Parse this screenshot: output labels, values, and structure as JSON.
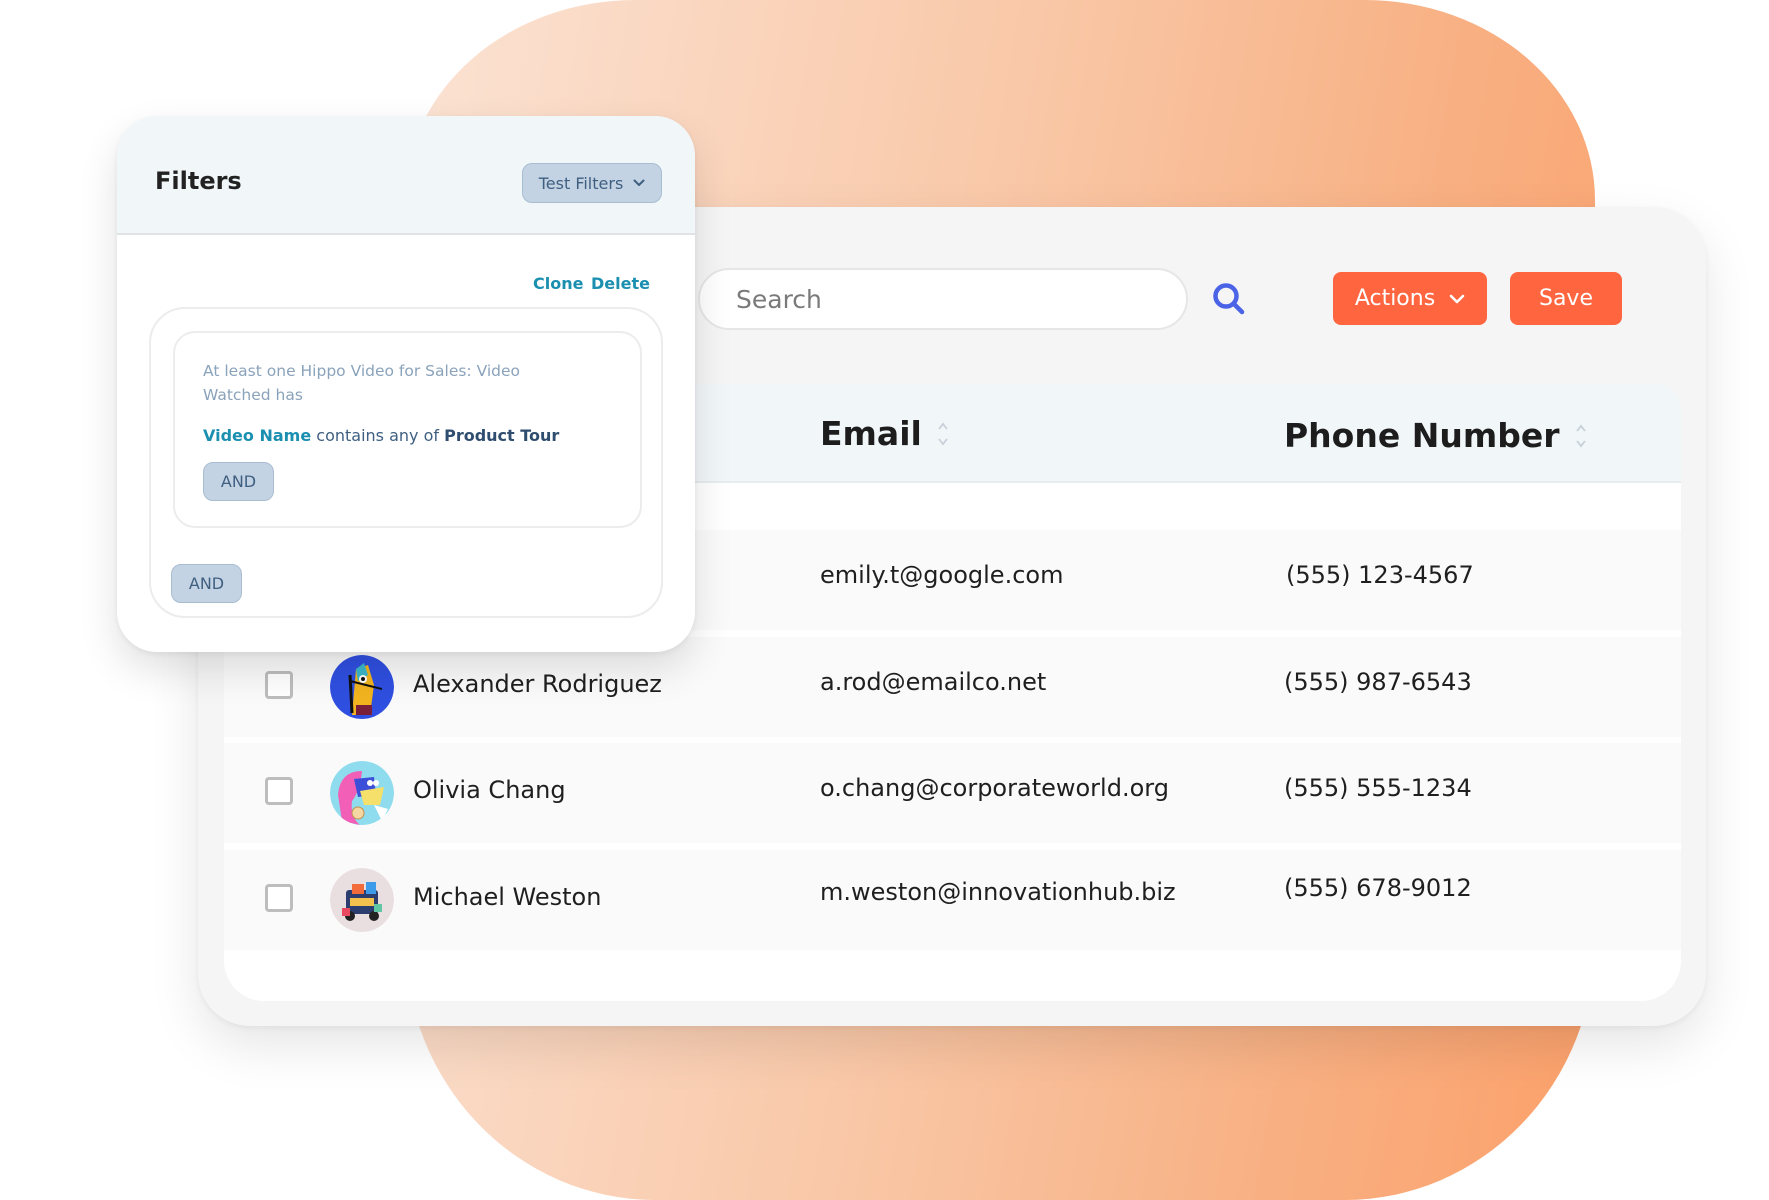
{
  "colors": {
    "accent_orange": "#ff6640",
    "search_icon_blue": "#4a63e7",
    "link_teal": "#1a8fb0",
    "chip_bg": "#c3d3e3",
    "chip_text": "#3f5f81",
    "header_bg": "#f1f6f9"
  },
  "toolbar": {
    "search_placeholder": "Search",
    "search_value": "",
    "search_icon": "search-icon",
    "actions_label": "Actions",
    "actions_icon": "chevron-down-icon",
    "save_label": "Save"
  },
  "table": {
    "columns": [
      {
        "label": "Email",
        "sortable": true
      },
      {
        "label": "Phone Number",
        "sortable": true
      }
    ],
    "rows": [
      {
        "name": "",
        "email": "emily.t@google.com",
        "phone": "(555) 123-4567",
        "checked": false
      },
      {
        "name": "Alexander Rodriguez",
        "email": "a.rod@emailco.net",
        "phone": "(555) 987-6543",
        "checked": false
      },
      {
        "name": "Olivia Chang",
        "email": "o.chang@corporateworld.org",
        "phone": "(555) 555-1234",
        "checked": false
      },
      {
        "name": "Michael Weston",
        "email": "m.weston@innovationhub.biz",
        "phone": "(555) 678-9012",
        "checked": false
      }
    ]
  },
  "filters": {
    "title": "Filters",
    "test_filters_label": "Test Filters",
    "clone_label": "Clone",
    "delete_label": "Delete",
    "condition": {
      "description": "At least one Hippo Video for Sales: Video Watched has",
      "field": "Video Name",
      "operator": "contains any of",
      "value": "Product Tour"
    },
    "inner_and_label": "AND",
    "outer_and_label": "AND"
  }
}
